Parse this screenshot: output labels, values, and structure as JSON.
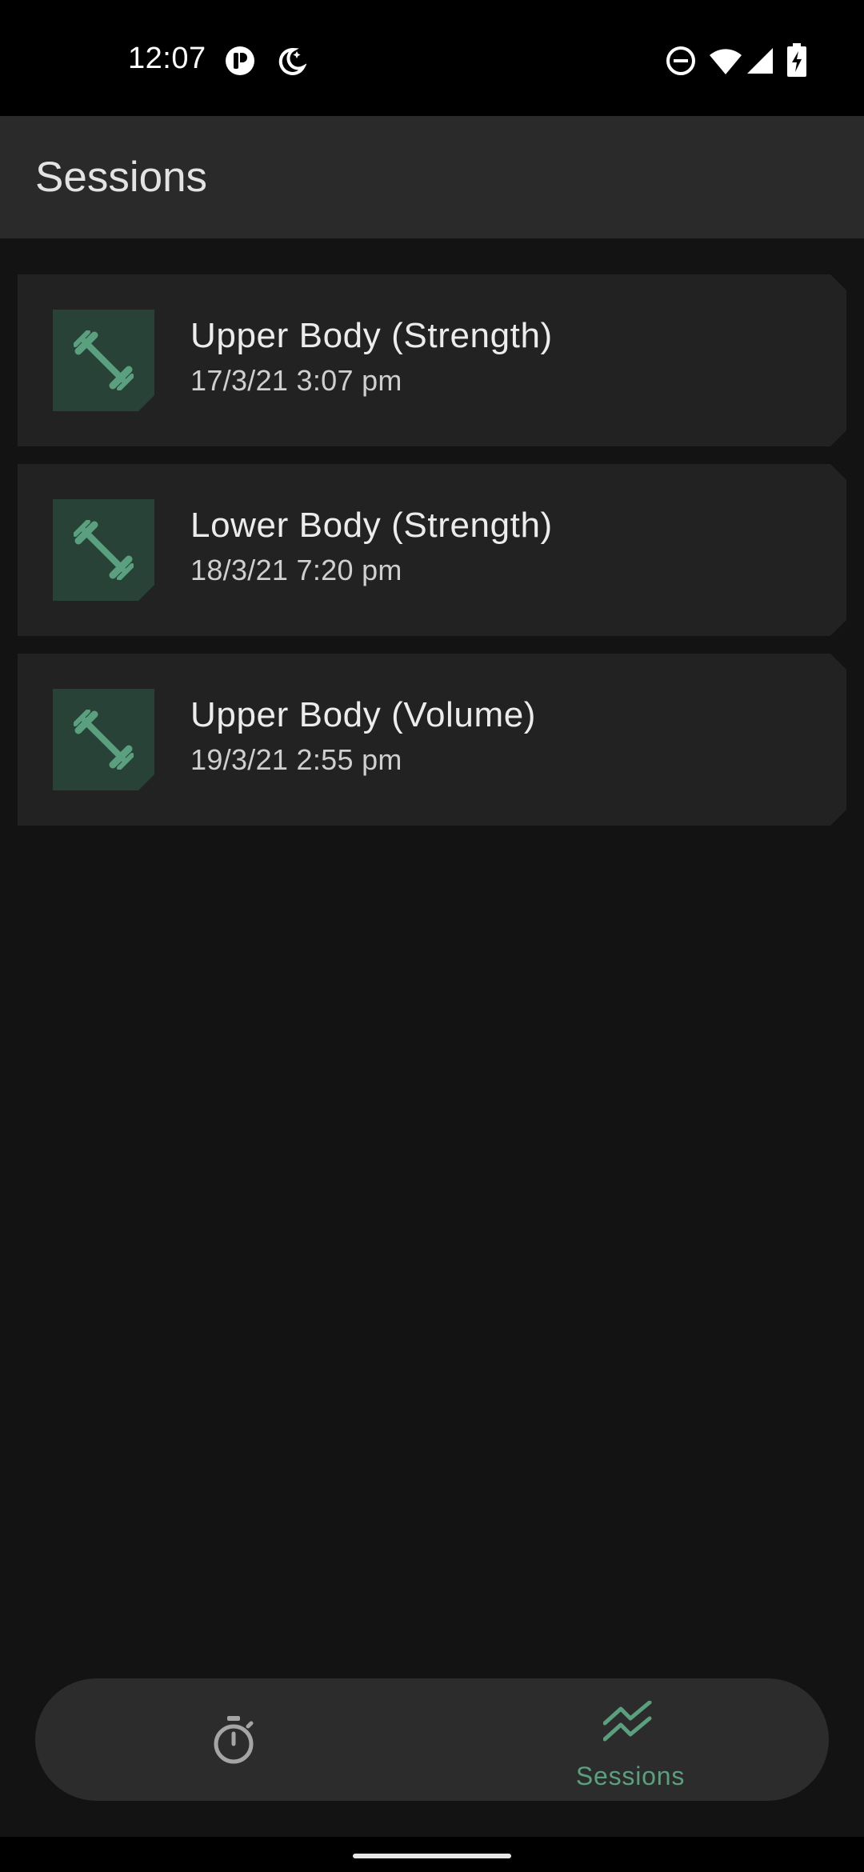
{
  "status_bar": {
    "time": "12:07",
    "icons": [
      "app-notification-icon",
      "do-not-disturb-moon-icon",
      "dnd-minus-icon",
      "wifi-icon",
      "signal-icon",
      "battery-charging-icon"
    ]
  },
  "app_bar": {
    "title": "Sessions"
  },
  "sessions": [
    {
      "name": "Upper Body (Strength)",
      "date": "17/3/21 3:07 pm",
      "icon": "dumbbell-icon"
    },
    {
      "name": "Lower Body (Strength)",
      "date": "18/3/21 7:20 pm",
      "icon": "dumbbell-icon"
    },
    {
      "name": "Upper Body (Volume)",
      "date": "19/3/21 2:55 pm",
      "icon": "dumbbell-icon"
    }
  ],
  "bottom_nav": {
    "items": [
      {
        "icon": "stopwatch-icon",
        "label": "",
        "selected": false
      },
      {
        "icon": "trending-up-icon",
        "label": "Sessions",
        "selected": true
      }
    ]
  },
  "colors": {
    "accent": "#5aa07e",
    "thumb_bg": "#284238",
    "card_bg": "#222222",
    "app_bar_bg": "#2a2a2a",
    "background": "#131313"
  }
}
